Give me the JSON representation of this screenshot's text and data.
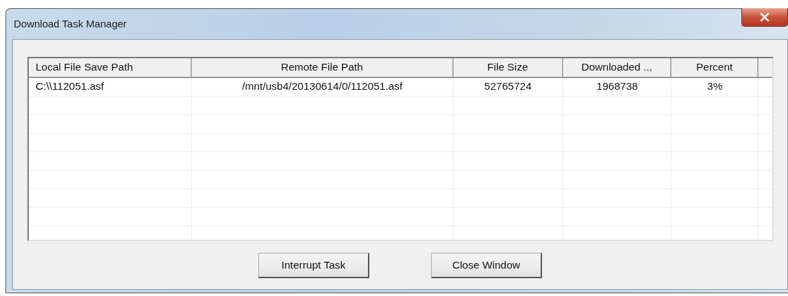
{
  "window": {
    "title": "Download Task Manager"
  },
  "table": {
    "columns": [
      "Local File Save Path",
      "Remote File Path",
      "File Size",
      "Downloaded ...",
      "Percent"
    ],
    "rows": [
      [
        "C:\\\\112051.asf",
        "/mnt/usb4/20130614/0/112051.asf",
        "52765724",
        "1968738",
        "3%"
      ]
    ]
  },
  "buttons": [
    "Interrupt Task",
    "Close Window"
  ]
}
